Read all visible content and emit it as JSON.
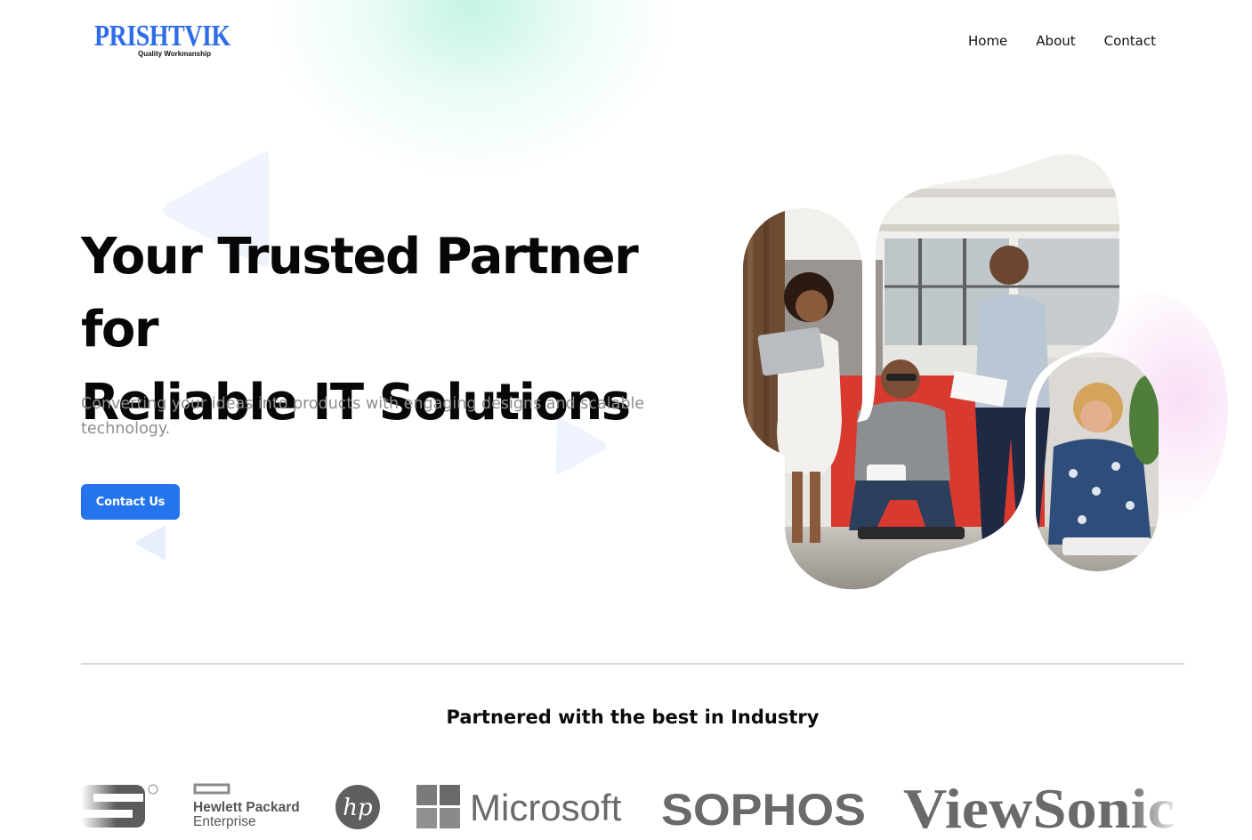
{
  "brand": {
    "name": "PRISHTVIK",
    "tagline": "Quality Workmanship",
    "color": "#2e6ce8"
  },
  "nav": {
    "items": [
      {
        "label": "Home"
      },
      {
        "label": "About"
      },
      {
        "label": "Contact"
      }
    ]
  },
  "hero": {
    "title_line1": "Your Trusted Partner for",
    "title_line2": "Reliable IT Solutions",
    "subtitle": "Converting your ideas into products with engaging designs and scalable technology.",
    "cta_label": "Contact Us",
    "cta_color": "#2474ee"
  },
  "partners": {
    "title": "Partnered with the best in Industry",
    "logos": [
      {
        "name": "partial-s-logo",
        "text": "S"
      },
      {
        "name": "hewlett-packard-enterprise-logo",
        "line1": "Hewlett Packard",
        "line2": "Enterprise"
      },
      {
        "name": "hp-logo",
        "text": "hp"
      },
      {
        "name": "microsoft-logo",
        "text": "Microsoft"
      },
      {
        "name": "sophos-logo",
        "text": "SOPHOS"
      },
      {
        "name": "viewsonic-logo",
        "text": "ViewSonic"
      }
    ]
  }
}
